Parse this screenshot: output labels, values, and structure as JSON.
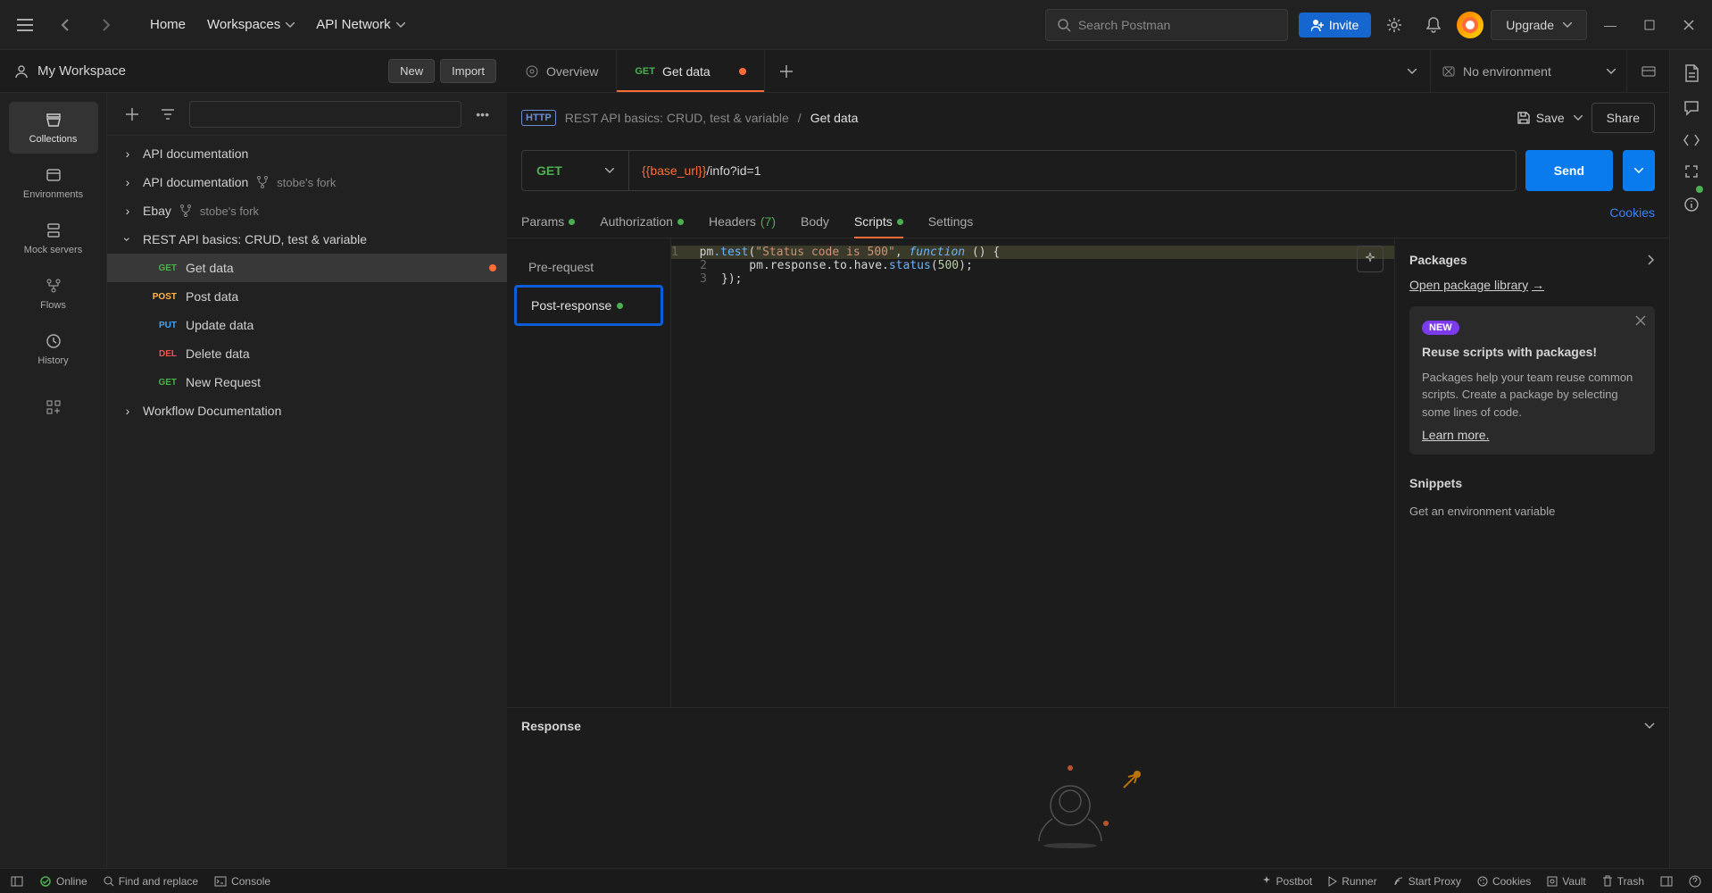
{
  "topbar": {
    "home": "Home",
    "workspaces": "Workspaces",
    "api_network": "API Network",
    "search_placeholder": "Search Postman",
    "invite": "Invite",
    "upgrade": "Upgrade"
  },
  "workspace": {
    "name": "My Workspace",
    "new_btn": "New",
    "import_btn": "Import"
  },
  "left_nav": [
    {
      "label": "Collections",
      "active": true
    },
    {
      "label": "Environments",
      "active": false
    },
    {
      "label": "Mock servers",
      "active": false
    },
    {
      "label": "Flows",
      "active": false
    },
    {
      "label": "History",
      "active": false
    }
  ],
  "tree": {
    "items": [
      {
        "type": "folder",
        "label": "API documentation"
      },
      {
        "type": "folder",
        "label": "API documentation",
        "fork": "stobe's fork"
      },
      {
        "type": "folder",
        "label": "Ebay",
        "fork": "stobe's fork"
      },
      {
        "type": "folder",
        "label": "REST API basics: CRUD, test & variable",
        "expanded": true,
        "children": [
          {
            "method": "GET",
            "label": "Get data",
            "selected": true,
            "unsaved": true
          },
          {
            "method": "POST",
            "label": "Post data"
          },
          {
            "method": "PUT",
            "label": "Update data"
          },
          {
            "method": "DEL",
            "label": "Delete data"
          },
          {
            "method": "GET",
            "label": "New Request"
          }
        ]
      },
      {
        "type": "folder",
        "label": "Workflow Documentation"
      }
    ]
  },
  "tabs": {
    "overview": "Overview",
    "active_method": "GET",
    "active_label": "Get data"
  },
  "env": {
    "selected": "No environment"
  },
  "breadcrumb": {
    "badge": "HTTP",
    "parent": "REST API basics: CRUD, test & variable",
    "sep": "/",
    "current": "Get data",
    "save": "Save",
    "share": "Share"
  },
  "request": {
    "method": "GET",
    "url_var": "{{base_url}}",
    "url_path": "/info?id=1",
    "send": "Send"
  },
  "req_tabs": {
    "params": "Params",
    "auth": "Authorization",
    "headers": "Headers",
    "headers_count": "(7)",
    "body": "Body",
    "scripts": "Scripts",
    "settings": "Settings",
    "cookies": "Cookies"
  },
  "scripts": {
    "pre": "Pre-request",
    "post": "Post-response",
    "code": {
      "l1a": "pm",
      "l1b": ".test",
      "l1c": "(",
      "l1d": "\"Status code is 500\"",
      "l1e": ", ",
      "l1f": "function",
      "l1g": " () {",
      "l2a": "    pm",
      "l2b": ".response.to.have.",
      "l2c": "status",
      "l2d": "(",
      "l2e": "500",
      "l2f": ");",
      "l3": "});"
    }
  },
  "packages": {
    "title": "Packages",
    "open_lib": "Open package library",
    "new": "NEW",
    "card_title": "Reuse scripts with packages!",
    "card_desc": "Packages help your team reuse common scripts. Create a package by selecting some lines of code.",
    "learn": "Learn more.",
    "snippets_title": "Snippets",
    "snippet1": "Get an environment variable"
  },
  "response": {
    "title": "Response"
  },
  "statusbar": {
    "online": "Online",
    "find": "Find and replace",
    "console": "Console",
    "postbot": "Postbot",
    "runner": "Runner",
    "proxy": "Start Proxy",
    "cookies": "Cookies",
    "vault": "Vault",
    "trash": "Trash"
  }
}
